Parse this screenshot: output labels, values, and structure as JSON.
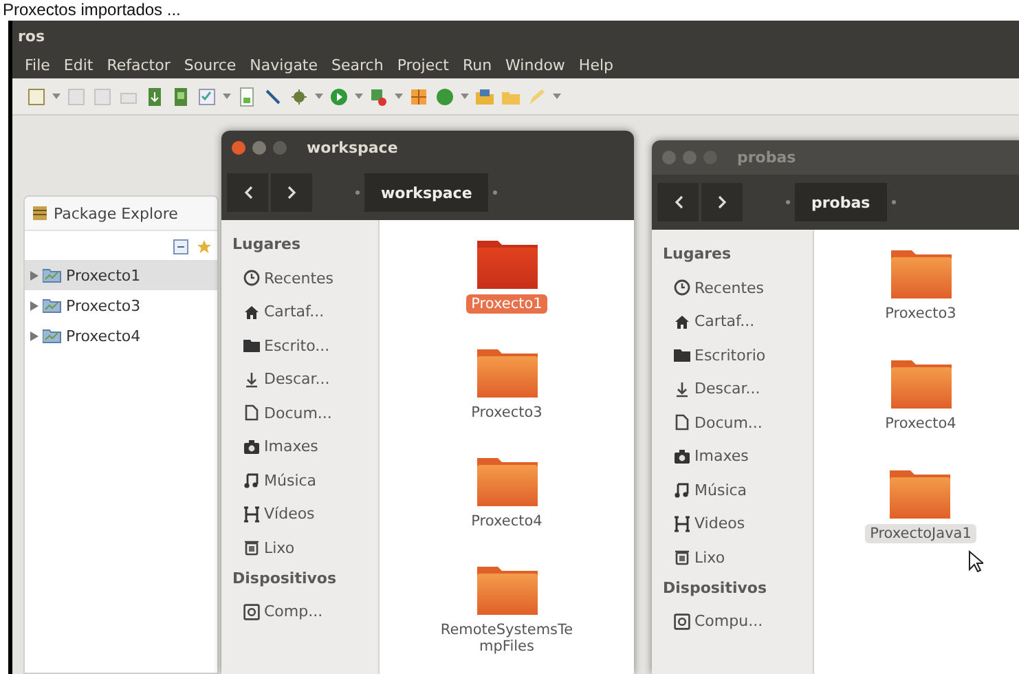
{
  "caption": "Proxectos importados ...",
  "eclipse": {
    "title": "ros",
    "menu": [
      "File",
      "Edit",
      "Refactor",
      "Source",
      "Navigate",
      "Search",
      "Project",
      "Run",
      "Window",
      "Help"
    ],
    "package_explorer": {
      "title": "Package Explore",
      "projects": [
        {
          "label": "Proxecto1",
          "selected": true
        },
        {
          "label": "Proxecto3",
          "selected": false
        },
        {
          "label": "Proxecto4",
          "selected": false
        }
      ]
    }
  },
  "windows": [
    {
      "title": "workspace",
      "active": true,
      "path": "workspace",
      "places_heading": "Lugares",
      "places": [
        {
          "kind": "recent",
          "label": "Recentes"
        },
        {
          "kind": "home",
          "label": "Cartaf..."
        },
        {
          "kind": "desktop",
          "label": "Escrito..."
        },
        {
          "kind": "download",
          "label": "Descar..."
        },
        {
          "kind": "documents",
          "label": "Docum..."
        },
        {
          "kind": "pictures",
          "label": "Imaxes"
        },
        {
          "kind": "music",
          "label": "Música"
        },
        {
          "kind": "videos",
          "label": "Vídeos"
        },
        {
          "kind": "trash",
          "label": "Lixo"
        }
      ],
      "devices_heading": "Dispositivos",
      "devices": [
        {
          "kind": "drive",
          "label": "Comp..."
        }
      ],
      "files": [
        {
          "name": "Proxecto1",
          "selected": true
        },
        {
          "name": "Proxecto3",
          "selected": false
        },
        {
          "name": "Proxecto4",
          "selected": false
        },
        {
          "name": "RemoteSystemsTempFiles",
          "selected": false
        }
      ]
    },
    {
      "title": "probas",
      "active": false,
      "path": "probas",
      "places_heading": "Lugares",
      "places": [
        {
          "kind": "recent",
          "label": "Recentes"
        },
        {
          "kind": "home",
          "label": "Cartaf..."
        },
        {
          "kind": "desktop",
          "label": "Escritorio"
        },
        {
          "kind": "download",
          "label": "Descar..."
        },
        {
          "kind": "documents",
          "label": "Docum..."
        },
        {
          "kind": "pictures",
          "label": "Imaxes"
        },
        {
          "kind": "music",
          "label": "Música"
        },
        {
          "kind": "videos",
          "label": "Videos"
        },
        {
          "kind": "trash",
          "label": "Lixo"
        }
      ],
      "devices_heading": "Dispositivos",
      "devices": [
        {
          "kind": "drive",
          "label": "Compu..."
        }
      ],
      "files": [
        {
          "name": "Proxecto3",
          "selected": false
        },
        {
          "name": "Proxecto4",
          "selected": false
        },
        {
          "name": "ProxectoJava1",
          "selected": true
        }
      ]
    }
  ]
}
